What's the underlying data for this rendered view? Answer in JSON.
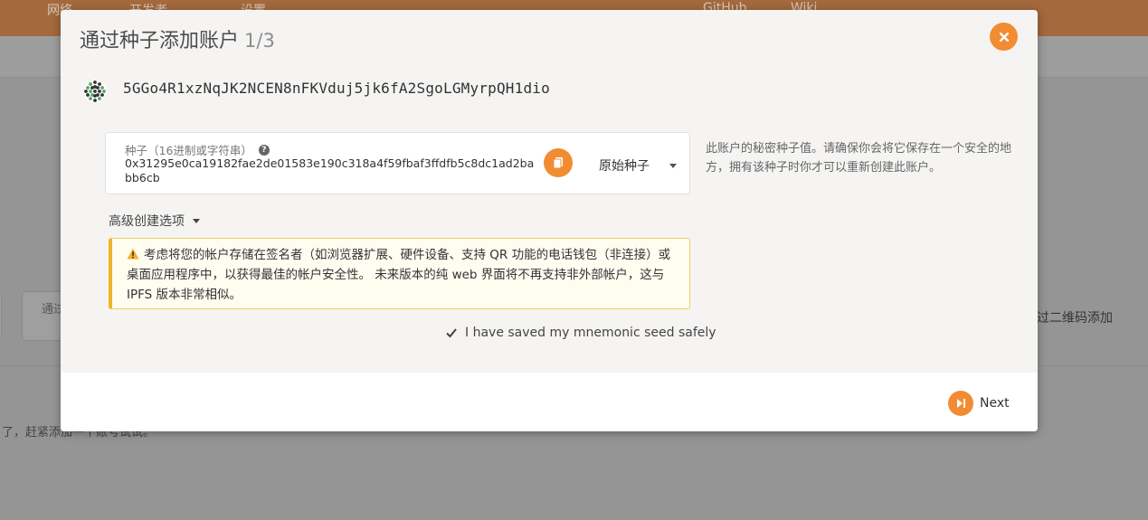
{
  "background": {
    "topbar_items": [
      "网络",
      "开发者",
      "设置",
      "GitHub",
      "Wiki"
    ],
    "card_text": "通过",
    "right_text": "过二维码添加",
    "bottom_text": "了，赶紧添加一个账号试试。"
  },
  "modal": {
    "title": "通过种子添加账户",
    "step": "1/3",
    "close_icon": "close-icon",
    "address": "5GGo4R1xzNqJK2NCEN8nFKVduj5jk6fA2SgoLGMyrpQH1dio",
    "seed": {
      "label": "种子（16进制或字符串）",
      "value": "0x31295e0ca19182fae2de01583e190c318a4f59fbaf3ffdfb5c8dc1ad2babb6cb",
      "type_selected": "原始种子",
      "help": "此账户的秘密种子值。请确保你会将它保存在一个安全的地方，拥有该种子时你才可以重新创建此账户。"
    },
    "advanced_label": "高级创建选项",
    "warning": "考虑将您的帐户存储在签名者（如浏览器扩展、硬件设备、支持 QR 功能的电话钱包（非连接）或桌面应用程序中，以获得最佳的帐户安全性。 未来版本的纯 web 界面将不再支持非外部帐户，这与 IPFS 版本非常相似。",
    "confirm_label": "I have saved my mnemonic seed safely",
    "confirm_checked": true,
    "next_label": "Next"
  },
  "colors": {
    "accent": "#f28c32",
    "warning_border": "#f0b429",
    "warning_bg": "#fffcf0"
  }
}
